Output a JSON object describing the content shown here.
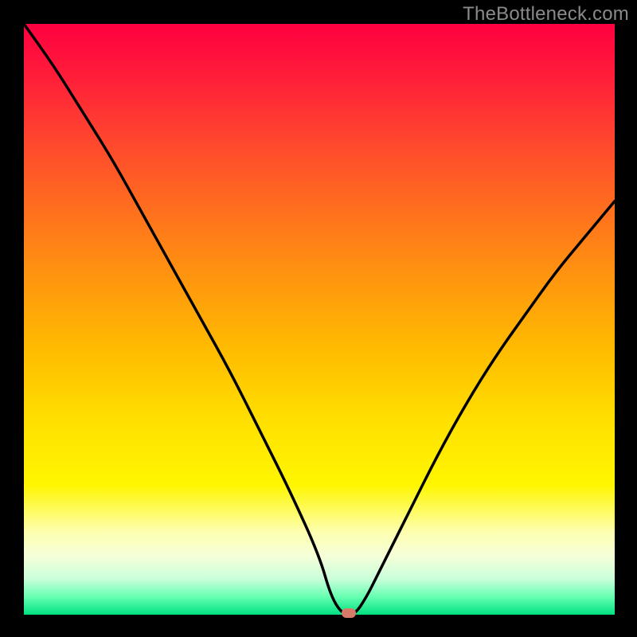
{
  "watermark": "TheBottleneck.com",
  "colors": {
    "frame": "#000000",
    "curve": "#000000",
    "marker": "#d87a6a",
    "gradient_top": "#ff0040",
    "gradient_bottom": "#00e080"
  },
  "chart_data": {
    "type": "line",
    "title": "",
    "xlabel": "",
    "ylabel": "",
    "xlim": [
      0,
      100
    ],
    "ylim": [
      0,
      100
    ],
    "series": [
      {
        "name": "bottleneck-curve",
        "x": [
          0,
          5,
          10,
          15,
          20,
          25,
          30,
          35,
          40,
          45,
          50,
          52,
          54,
          56,
          58,
          60,
          65,
          70,
          75,
          80,
          85,
          90,
          95,
          100
        ],
        "values": [
          100,
          93,
          85,
          77,
          68,
          59,
          50,
          41,
          31,
          21,
          10,
          3,
          0,
          0,
          3,
          7,
          17,
          27,
          36,
          44,
          51,
          58,
          64,
          70
        ]
      }
    ],
    "annotations": [
      {
        "name": "optimal-marker",
        "x": 55,
        "y": 0
      }
    ]
  }
}
